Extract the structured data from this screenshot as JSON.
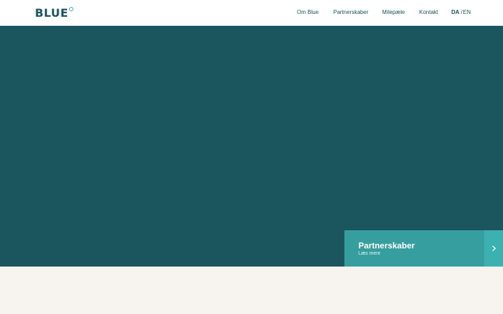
{
  "header": {
    "logo_text": "BLUE",
    "nav": [
      {
        "label": "Om Blue"
      },
      {
        "label": "Partnerskaber"
      },
      {
        "label": "Milepæle"
      },
      {
        "label": "Kontakt"
      }
    ],
    "language": {
      "active": "DA",
      "separator": "/",
      "other": "EN"
    }
  },
  "hero": {
    "card": {
      "title": "Partnerskaber",
      "subtitle": "Læs mere",
      "arrow_icon": "chevron-right-icon"
    }
  },
  "colors": {
    "brand_dark": "#1b555e",
    "accent": "#379e9f",
    "accent_light": "#3db0b0",
    "background": "#f7f3ee",
    "text_dark": "#1b535c"
  }
}
